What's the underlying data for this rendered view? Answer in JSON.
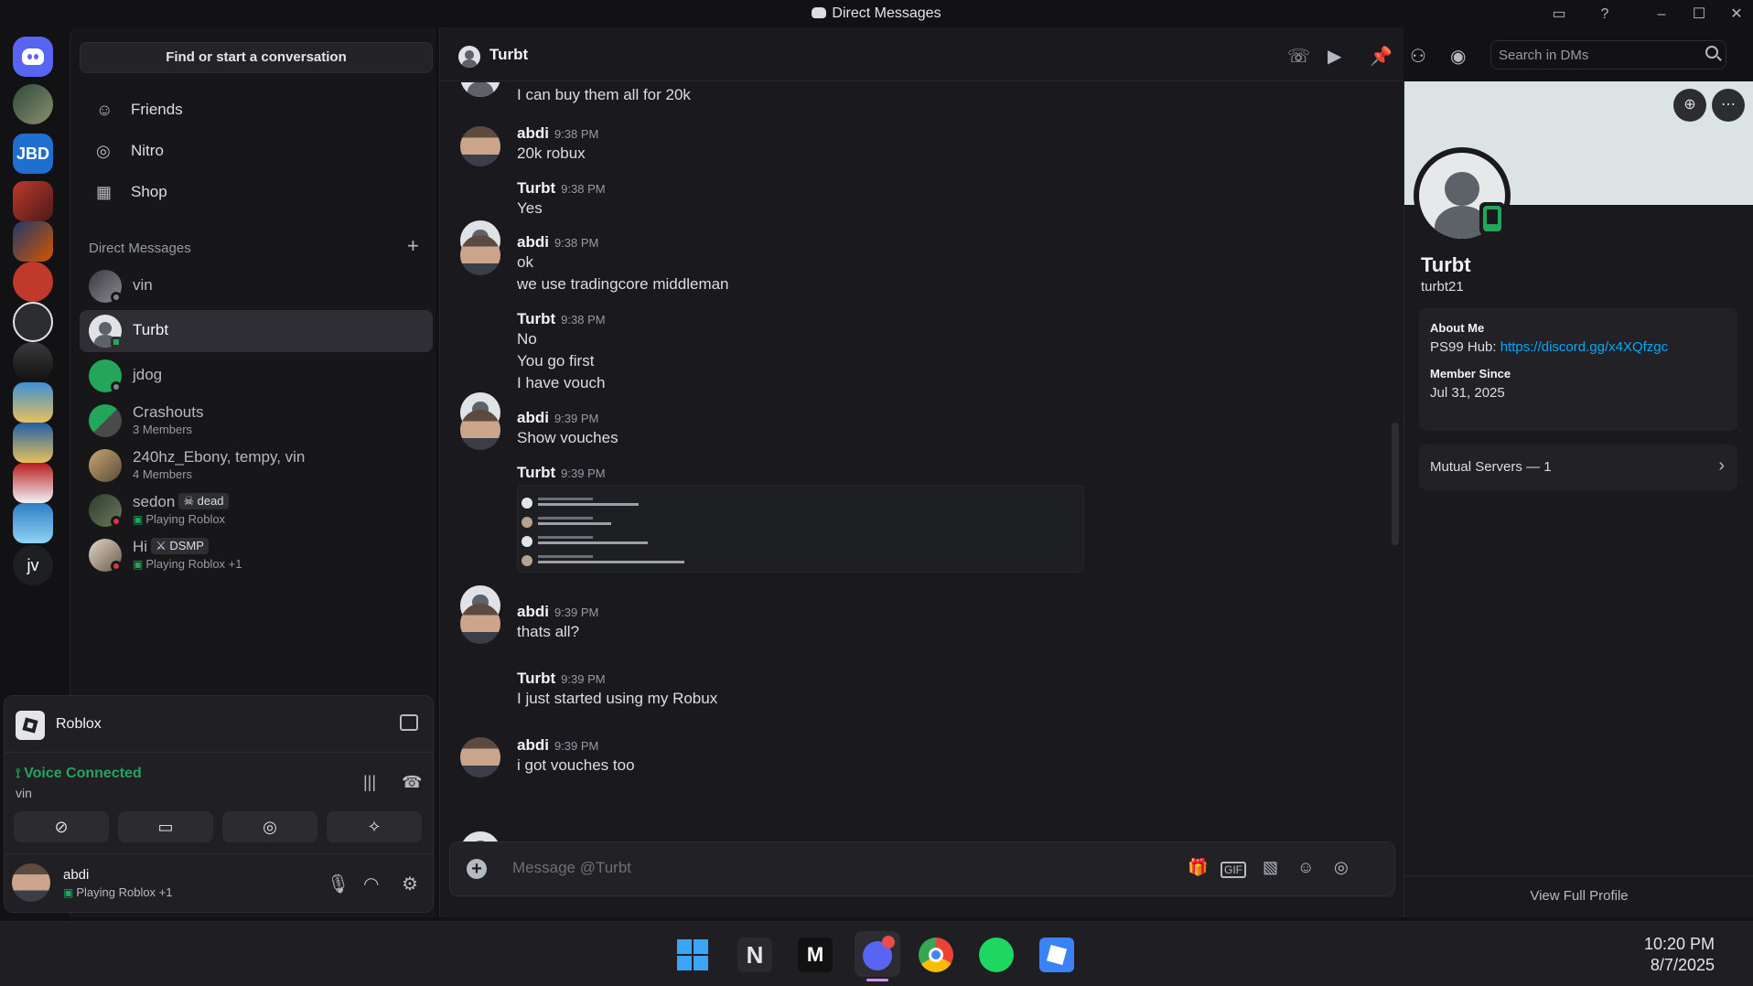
{
  "window": {
    "title": "Direct Messages"
  },
  "sidebar": {
    "find_label": "Find or start a conversation",
    "nav": [
      {
        "label": "Friends",
        "icon": "friends-icon"
      },
      {
        "label": "Nitro",
        "icon": "nitro-icon"
      },
      {
        "label": "Shop",
        "icon": "shop-icon"
      }
    ],
    "dm_header": "Direct Messages",
    "dms": [
      {
        "name": "vin",
        "sub": ""
      },
      {
        "name": "Turbt",
        "sub": ""
      },
      {
        "name": "jdog",
        "sub": ""
      },
      {
        "name": "Crashouts",
        "sub": "3 Members"
      },
      {
        "name": "240hz_Ebony, tempy, vin",
        "sub": "4 Members"
      },
      {
        "name": "sedon",
        "tag": "dead",
        "sub": "Playing Roblox"
      },
      {
        "name": "Hi",
        "tag": "DSMP",
        "sub": "Playing Roblox +1"
      }
    ],
    "server_rail": [
      {
        "label": "JBD"
      },
      {
        "label": "jv"
      }
    ]
  },
  "voice_panel": {
    "activity_game": "Roblox",
    "status": "Voice Connected",
    "channel": "vin",
    "user": {
      "name": "abdi",
      "sub": "Playing Roblox +1"
    }
  },
  "chat": {
    "recipient": "Turbt",
    "search_placeholder": "Search in DMs",
    "partial_top": "I can buy them all for 20k",
    "groups": [
      {
        "author": "abdi",
        "time": "9:38 PM",
        "lines": [
          "20k robux"
        ]
      },
      {
        "author": "Turbt",
        "time": "9:38 PM",
        "lines": [
          "Yes"
        ]
      },
      {
        "author": "abdi",
        "time": "9:38 PM",
        "lines": [
          "ok",
          "we use tradingcore middleman"
        ]
      },
      {
        "author": "Turbt",
        "time": "9:38 PM",
        "lines": [
          "No",
          "You go first",
          "I have vouch"
        ]
      },
      {
        "author": "abdi",
        "time": "9:39 PM",
        "lines": [
          "Show vouches"
        ]
      },
      {
        "author": "Turbt",
        "time": "9:39 PM",
        "lines": []
      },
      {
        "author": "abdi",
        "time": "9:39 PM",
        "lines": [
          "thats all?"
        ]
      },
      {
        "author": "Turbt",
        "time": "9:39 PM",
        "lines": [
          "I just started using my Robux"
        ]
      },
      {
        "author": "abdi",
        "time": "9:39 PM",
        "lines": [
          "i got vouches too"
        ]
      }
    ],
    "composer_placeholder": "Message @Turbt"
  },
  "profile": {
    "display_name": "Turbt",
    "username": "turbt21",
    "about_label": "About Me",
    "about_text": "PS99 Hub: ",
    "about_link": "https://discord.gg/x4XQfzgc",
    "member_since_label": "Member Since",
    "member_since": "Jul 31, 2025",
    "mutual_servers": "Mutual Servers — 1",
    "view_full": "View Full Profile"
  },
  "taskbar": {
    "time": "10:20 PM",
    "date": "8/7/2025"
  },
  "colors": {
    "accent": "#5865f2",
    "online": "#23a55a",
    "dnd": "#da373c",
    "link": "#00a8fc"
  }
}
